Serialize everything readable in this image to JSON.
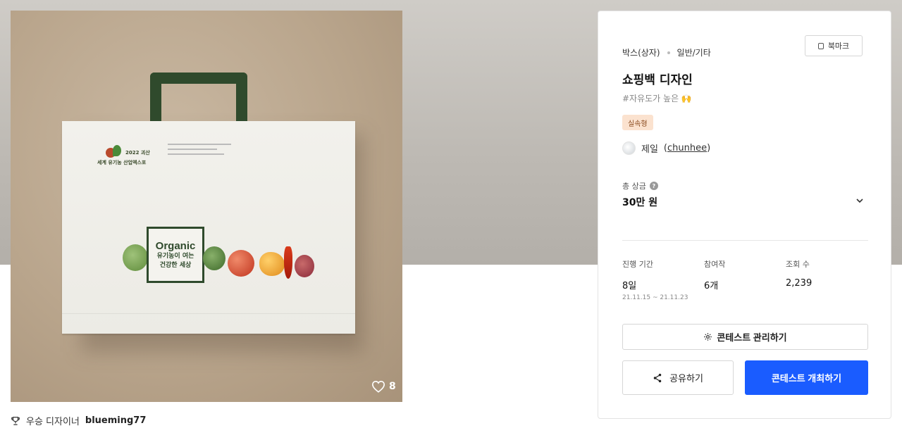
{
  "product": {
    "likes_count": "8",
    "bag_print": {
      "logo_year": "2022 괴산",
      "logo_text": "세계 유기농 산업엑스포",
      "organic_title": "Organic",
      "organic_sub_1": "유기농이 여는",
      "organic_sub_2": "건강한 세상"
    }
  },
  "award": {
    "label": "우승 디자이너",
    "designer": "blueming77"
  },
  "contest": {
    "category": "박스(상자)",
    "subcategory": "일반/기타",
    "bookmark_label": "북마크",
    "title": "쇼핑백 디자인",
    "tagline": "#자유도가 높은 🙌",
    "type_badge": "실속형",
    "host_name": "제일",
    "host_id": "chunhee",
    "prize_label": "총 상금",
    "prize_value": "30만 원",
    "stats": {
      "period_label": "진행 기간",
      "period_value": "8일",
      "period_range": "21.11.15 ~ 21.11.23",
      "entries_label": "참여작",
      "entries_value": "6개",
      "views_label": "조회 수",
      "views_value": "2,239"
    },
    "manage_label": "콘테스트 관리하기",
    "share_label": "공유하기",
    "host_contest_label": "콘테스트 개최하기"
  },
  "colors": {
    "primary": "#1a5cff",
    "badge_bg": "#fbe2cf",
    "bag_green": "#2f4a2c"
  },
  "icons": [
    "heart-icon",
    "trophy-icon",
    "bookmark-icon",
    "help-icon",
    "chevron-down-icon",
    "gear-icon",
    "share-icon"
  ]
}
